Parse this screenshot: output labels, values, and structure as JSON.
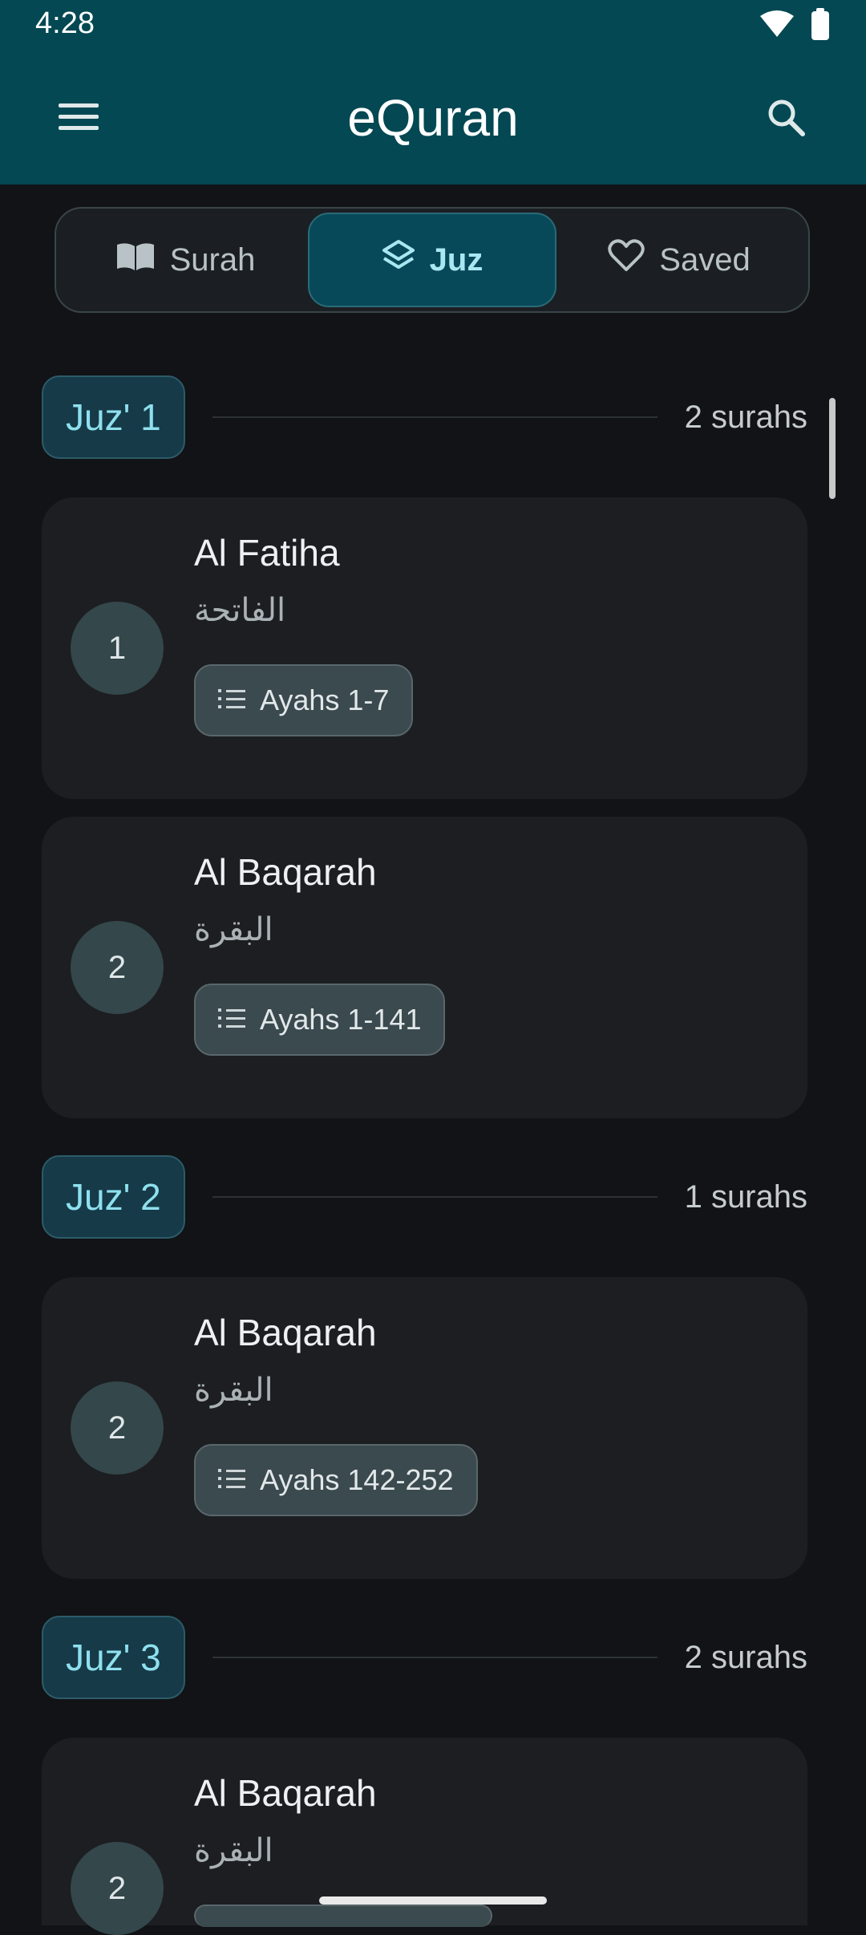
{
  "status_bar": {
    "time": "4:28"
  },
  "app": {
    "title": "eQuran"
  },
  "tabs": [
    {
      "label": "Surah",
      "icon": "book-open-icon",
      "active": false
    },
    {
      "label": "Juz",
      "icon": "layers-icon",
      "active": true
    },
    {
      "label": "Saved",
      "icon": "heart-icon",
      "active": false
    }
  ],
  "juz": [
    {
      "label": "Juz' 1",
      "count": "2 surahs",
      "surahs": [
        {
          "number": "1",
          "name": "Al Fatiha",
          "arabic": "الفاتحة",
          "ayahs": "Ayahs 1-7"
        },
        {
          "number": "2",
          "name": "Al Baqarah",
          "arabic": "البقرة",
          "ayahs": "Ayahs 1-141"
        }
      ]
    },
    {
      "label": "Juz' 2",
      "count": "1 surahs",
      "surahs": [
        {
          "number": "2",
          "name": "Al Baqarah",
          "arabic": "البقرة",
          "ayahs": "Ayahs 142-252"
        }
      ]
    },
    {
      "label": "Juz' 3",
      "count": "2 surahs",
      "surahs": [
        {
          "number": "2",
          "name": "Al Baqarah",
          "arabic": "البقرة",
          "ayahs": ""
        }
      ]
    }
  ],
  "colors": {
    "header_bg": "#034853",
    "body_bg": "#111316",
    "card_bg": "#1c1e22",
    "accent": "#8fe0ee",
    "tab_active_bg": "#084959"
  }
}
